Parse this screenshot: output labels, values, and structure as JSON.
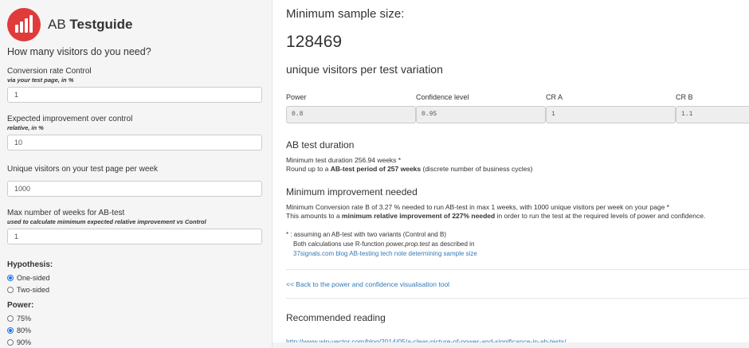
{
  "brand": {
    "prefix": "AB ",
    "name": "Testguide"
  },
  "sidebar": {
    "question": "How many visitors do you need?",
    "fields": [
      {
        "label": "Conversion rate Control",
        "sub": "via your test page, in %",
        "value": "1"
      },
      {
        "label": "Expected improvement over control",
        "sub": "relative, in %",
        "value": "10"
      },
      {
        "label": "Unique visitors on your test page per week",
        "sub": "",
        "value": "1000"
      },
      {
        "label": "Max number of weeks for AB-test",
        "sub": "used to calculate mimimum expected relative improvement vs Control",
        "value": "1"
      }
    ],
    "hypothesis": {
      "title": "Hypothesis:",
      "options": [
        "One-sided",
        "Two-sided"
      ],
      "selected": "One-sided"
    },
    "power": {
      "title": "Power:",
      "options": [
        "75%",
        "80%",
        "90%"
      ],
      "selected": "80%"
    }
  },
  "main": {
    "min_title": "Minimum sample size:",
    "sample_size": "128469",
    "unique_text": "unique visitors per test variation",
    "params": [
      {
        "label": "Power",
        "value": "0.8"
      },
      {
        "label": "Confidence level",
        "value": "0.95"
      },
      {
        "label": "CR A",
        "value": "1"
      },
      {
        "label": "CR B",
        "value": "1.1"
      }
    ],
    "duration": {
      "title": "AB test duration",
      "line1": "Minimum test duration 256.94 weeks *",
      "line2_pre": "Round up to a ",
      "line2_bold": "AB-test period of 257 weeks",
      "line2_post": " (discrete number of business cycles)"
    },
    "improvement": {
      "title": "Minimum improvement needed",
      "line1": "Minimum Conversion rate B of 3.27 % needed to run AB-test in max 1 weeks, with 1000 unique visitors per week on your page *",
      "line2_pre": "This amounts to a ",
      "line2_bold": "minimum relative improvement of 227% needed",
      "line2_post": " in order to run the test at the required levels of power and confidence."
    },
    "notes": {
      "line1": "* : assuming an AB-test with two variants (Control and B)",
      "line2_pre": "Both calculations use R-function ",
      "line2_italic": "power.prop.test",
      "line2_post": " as described in",
      "link": "37signals.com blog AB-testing tech note determining sample size"
    },
    "back_link": "<< Back to the power and confidence visualisation tool",
    "reading_title": "Recommended reading",
    "reading_url": "http://www.win-vector.com/blog/2014/05/a-clear-picture-of-power-and-significance-in-ab-tests/"
  },
  "colors": {
    "accent": "#e03b3b",
    "link": "#337ab7",
    "radio": "#1a73e8"
  }
}
